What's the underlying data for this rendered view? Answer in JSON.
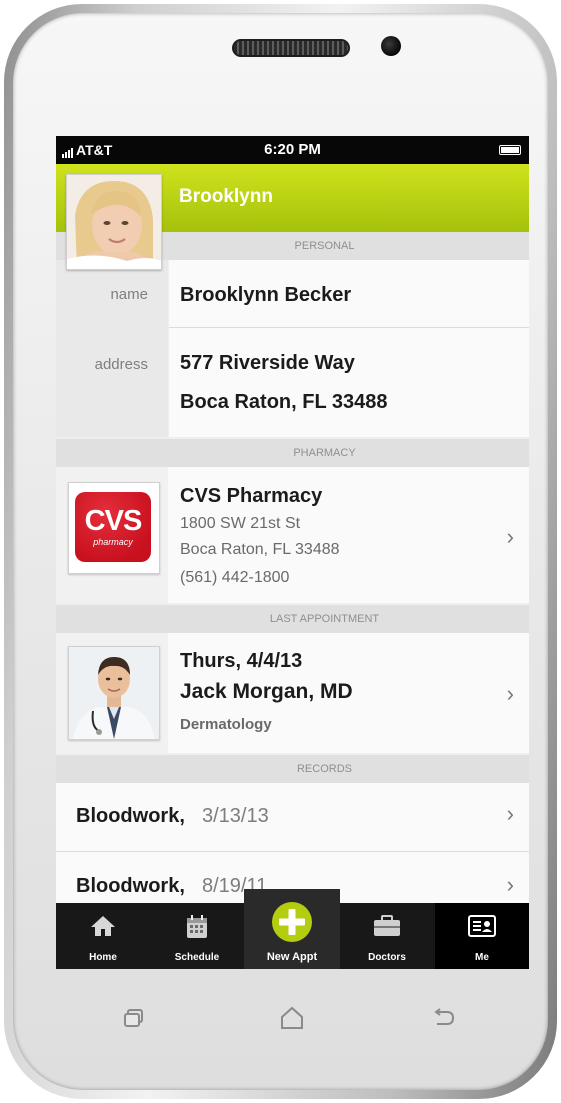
{
  "status": {
    "carrier": "AT&T",
    "time": "6:20 PM"
  },
  "profile": {
    "name": "Brooklynn"
  },
  "personal": {
    "section_title": "PERSONAL",
    "name_label": "name",
    "name_value": "Brooklynn Becker",
    "address_label": "address",
    "address_line1": "577 Riverside Way",
    "address_line2": "Boca Raton, FL 33488"
  },
  "pharmacy": {
    "section_title": "PHARMACY",
    "logo_text": "CVS",
    "logo_sub": "pharmacy",
    "name": "CVS Pharmacy",
    "street": "1800 SW 21st St",
    "city": "Boca Raton, FL 33488",
    "phone": "(561) 442-1800"
  },
  "appointment": {
    "section_title": "LAST APPOINTMENT",
    "date": "Thurs, 4/4/13",
    "doctor": "Jack Morgan, MD",
    "specialty": "Dermatology"
  },
  "records": {
    "section_title": "RECORDS",
    "items": [
      {
        "title": "Bloodwork,",
        "date": "3/13/13"
      },
      {
        "title": "Bloodwork,",
        "date": "8/19/11"
      }
    ]
  },
  "tabbar": {
    "tabs": [
      {
        "label": "Home",
        "icon": "home-icon"
      },
      {
        "label": "Schedule",
        "icon": "calendar-icon"
      },
      {
        "label": "New Appt",
        "icon": "plus-icon"
      },
      {
        "label": "Doctors",
        "icon": "briefcase-icon"
      },
      {
        "label": "Me",
        "icon": "id-card-icon"
      }
    ],
    "active": "Me"
  },
  "colors": {
    "accent": "#b4cd10",
    "tabbar": "#181818",
    "cvs_red": "#d3141f"
  }
}
